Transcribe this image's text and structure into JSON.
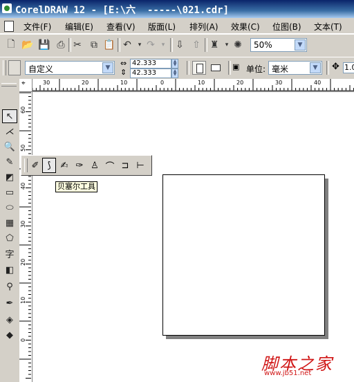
{
  "window": {
    "title": "CorelDRAW 12 - [E:\\六  -----\\021.cdr]"
  },
  "menu": [
    {
      "label": "文件(F)"
    },
    {
      "label": "编辑(E)"
    },
    {
      "label": "查看(V)"
    },
    {
      "label": "版面(L)"
    },
    {
      "label": "排列(A)"
    },
    {
      "label": "效果(C)"
    },
    {
      "label": "位图(B)"
    },
    {
      "label": "文本(T)"
    }
  ],
  "toolbar": {
    "icons": [
      "new-icon",
      "open-icon",
      "save-icon",
      "print-icon",
      "cut-icon",
      "copy-icon",
      "paste-icon",
      "undo-icon",
      "redo-icon",
      "import-icon",
      "export-icon",
      "app-launcher-icon",
      "corel-online-icon"
    ],
    "zoom": "50%"
  },
  "propbar": {
    "paper_preset": "自定义",
    "width": "42.333 mm",
    "height": "42.333 mm",
    "units_label": "单位:",
    "units": "毫米",
    "nudge_value": "1.0"
  },
  "ruler": {
    "top_labels": [
      "30",
      "20",
      "10",
      "0",
      "10",
      "20",
      "30",
      "40"
    ],
    "left_labels": [
      "60",
      "50",
      "40",
      "30",
      "20",
      "10",
      "0"
    ]
  },
  "toolbox": [
    "pick-tool-icon",
    "shape-tool-icon",
    "zoom-tool-icon",
    "freehand-tool-icon",
    "smart-fill-icon",
    "rectangle-tool-icon",
    "ellipse-tool-icon",
    "graph-paper-icon",
    "basic-shapes-icon",
    "text-tool-icon",
    "interactive-blend-icon",
    "eyedropper-icon",
    "outline-pen-icon",
    "fill-tool-icon",
    "interactive-fill-icon"
  ],
  "flyout": {
    "tools": [
      "freehand-icon",
      "bezier-icon",
      "artistic-media-icon",
      "pen-icon",
      "polyline-icon",
      "3-point-curve-icon",
      "interactive-connector-icon",
      "dimension-tool-icon"
    ],
    "tooltip": "贝塞尔工具"
  },
  "watermark": {
    "main": "脚本之家",
    "url": "www.jb51.net"
  }
}
